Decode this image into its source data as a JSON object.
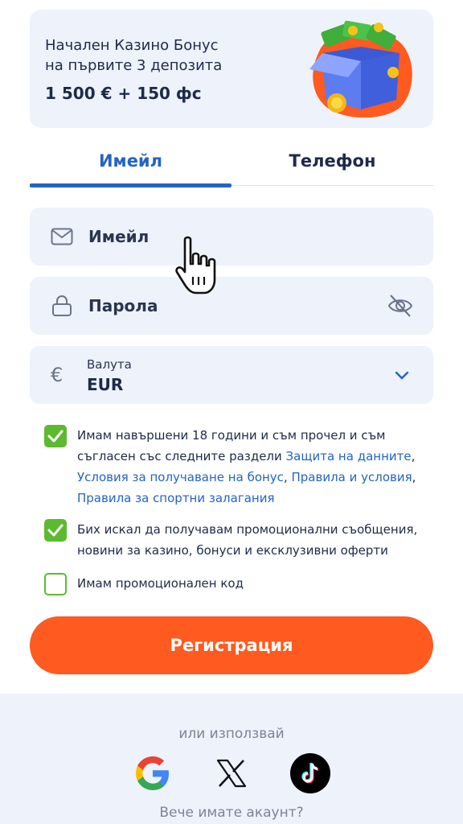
{
  "banner": {
    "line1": "Начален Казино Бонус",
    "line2": "на първите 3 депозита",
    "amount": "1 500 € + 150 фс"
  },
  "tabs": [
    {
      "label": "Имейл",
      "active": true
    },
    {
      "label": "Телефон",
      "active": false
    }
  ],
  "form": {
    "email_placeholder": "Имейл",
    "password_placeholder": "Парола",
    "currency_label": "Валута",
    "currency_value": "EUR",
    "currency_symbol": "€"
  },
  "consents": {
    "age": {
      "checked": true,
      "text_before": "Имам навършени 18 години и съм прочел и съм съгласен със следните раздели ",
      "link_privacy": "Защита на данните",
      "sep1": ", ",
      "link_bonus": "Условия за получаване на бонус",
      "sep2": ", ",
      "link_terms": "Правила и условия",
      "sep3": ", ",
      "link_sports": "Правила за спортни залагания"
    },
    "promo_messages": {
      "checked": true,
      "text": "Бих искал да получавам промоционални съобщения, новини за казино, бонуси и ексклузивни оферти"
    },
    "promo_code": {
      "checked": false,
      "text": "Имам промоционален код"
    }
  },
  "register_label": "Регистрация",
  "footer": {
    "or_use": "или използвай",
    "social": [
      "google-icon",
      "x-icon",
      "tiktok-icon"
    ],
    "have_account": "Вече имате акаунт?"
  },
  "colors": {
    "accent_blue": "#2364c4",
    "cta_orange": "#ff5a1f",
    "check_green": "#5dba2f",
    "field_bg": "#eef2fb"
  }
}
